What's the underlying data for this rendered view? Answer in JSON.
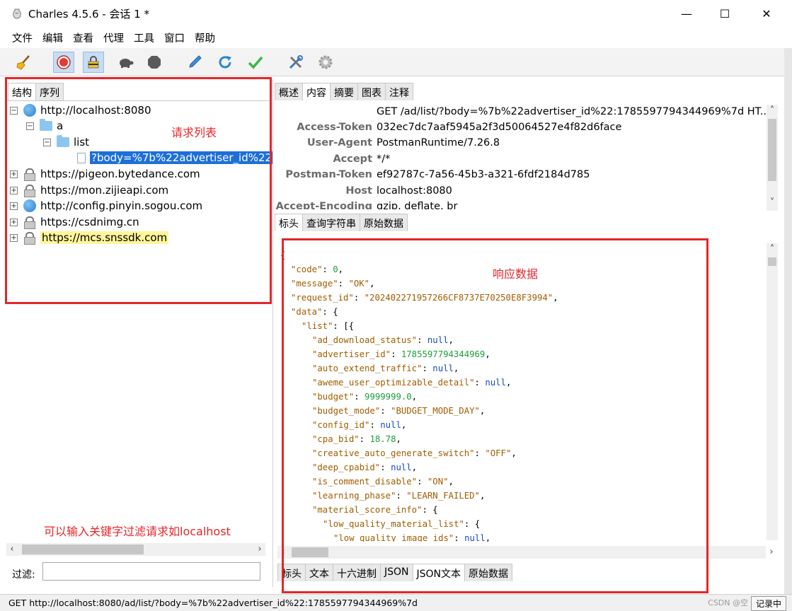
{
  "window": {
    "title": "Charles 4.5.6 - 会话 1 *",
    "minimize": "—",
    "maximize": "☐",
    "close": "✕"
  },
  "menu": [
    "文件",
    "编辑",
    "查看",
    "代理",
    "工具",
    "窗口",
    "帮助"
  ],
  "toolbar": {
    "buttons": [
      "broom-icon",
      "record-icon",
      "ssl-lock-icon",
      "throttle-turtle-icon",
      "breakpoint-hexagon-icon",
      "compose-pen-icon",
      "repeat-icon",
      "validate-check-icon",
      "tools-icon",
      "settings-gear-icon"
    ]
  },
  "left": {
    "tabs": [
      "结构",
      "序列"
    ],
    "tree": [
      {
        "label": "http://localhost:8080",
        "kind": "http",
        "expanded": true
      },
      {
        "label": "a",
        "kind": "folder"
      },
      {
        "label": "list",
        "kind": "folder"
      },
      {
        "label": "?body=%7b%22advertiser_id%22",
        "kind": "request",
        "selected": true
      },
      {
        "label": "https://pigeon.bytedance.com",
        "kind": "https"
      },
      {
        "label": "https://mon.zijieapi.com",
        "kind": "https"
      },
      {
        "label": "http://config.pinyin.sogou.com",
        "kind": "http"
      },
      {
        "label": "https://csdnimg.cn",
        "kind": "https"
      },
      {
        "label": "https://mcs.snssdk.com",
        "kind": "https",
        "highlighted": true
      }
    ],
    "filter_label": "过滤:",
    "filter_value": "",
    "annotation_list": "请求列表",
    "annotation_filter": "可以输入关键字过滤请求如localhost"
  },
  "right": {
    "tabs": [
      "概述",
      "内容",
      "摘要",
      "图表",
      "注释"
    ],
    "request_headers": [
      {
        "key": "",
        "value": "GET /ad/list/?body=%7b%22advertiser_id%22:1785597794344969%7d HT..."
      },
      {
        "key": "Access-Token",
        "value": "032ec7dc7aaf5945a2f3d50064527e4f82d6face"
      },
      {
        "key": "User-Agent",
        "value": "PostmanRuntime/7.26.8"
      },
      {
        "key": "Accept",
        "value": "*/*"
      },
      {
        "key": "Postman-Token",
        "value": "ef92787c-7a56-45b3-a321-6fdf2184d785"
      },
      {
        "key": "Host",
        "value": "localhost:8080"
      },
      {
        "key": "Accept-Encoding",
        "value": "gzip, deflate, br"
      }
    ],
    "request_tabs": [
      "标头",
      "查询字符串",
      "原始数据"
    ],
    "response_tabs": [
      "标头",
      "文本",
      "十六进制",
      "JSON",
      "JSON文本",
      "原始数据"
    ],
    "annotation_response": "响应数据",
    "json_lines": [
      {
        "indent": 0,
        "text": "{",
        "kind": "brace"
      },
      {
        "indent": 1,
        "key": "code",
        "value": "0",
        "type": "number",
        "comma": true
      },
      {
        "indent": 1,
        "key": "message",
        "value": "\"OK\"",
        "type": "string",
        "comma": true
      },
      {
        "indent": 1,
        "key": "request_id",
        "value": "\"202402271957266CF8737E70250E8F3994\"",
        "type": "string",
        "comma": true
      },
      {
        "indent": 1,
        "key": "data",
        "value": "{",
        "type": "punct",
        "comma": false
      },
      {
        "indent": 2,
        "key": "list",
        "value": "[{",
        "type": "punct",
        "comma": false
      },
      {
        "indent": 3,
        "key": "ad_download_status",
        "value": "null",
        "type": "null",
        "comma": true
      },
      {
        "indent": 3,
        "key": "advertiser_id",
        "value": "1785597794344969",
        "type": "number",
        "comma": true
      },
      {
        "indent": 3,
        "key": "auto_extend_traffic",
        "value": "null",
        "type": "null",
        "comma": true
      },
      {
        "indent": 3,
        "key": "aweme_user_optimizable_detail",
        "value": "null",
        "type": "null",
        "comma": true
      },
      {
        "indent": 3,
        "key": "budget",
        "value": "9999999.0",
        "type": "number",
        "comma": true
      },
      {
        "indent": 3,
        "key": "budget_mode",
        "value": "\"BUDGET_MODE_DAY\"",
        "type": "string",
        "comma": true
      },
      {
        "indent": 3,
        "key": "config_id",
        "value": "null",
        "type": "null",
        "comma": true
      },
      {
        "indent": 3,
        "key": "cpa_bid",
        "value": "18.78",
        "type": "number",
        "comma": true
      },
      {
        "indent": 3,
        "key": "creative_auto_generate_switch",
        "value": "\"OFF\"",
        "type": "string",
        "comma": true
      },
      {
        "indent": 3,
        "key": "deep_cpabid",
        "value": "null",
        "type": "null",
        "comma": true
      },
      {
        "indent": 3,
        "key": "is_comment_disable",
        "value": "\"ON\"",
        "type": "string",
        "comma": true
      },
      {
        "indent": 3,
        "key": "learning_phase",
        "value": "\"LEARN_FAILED\"",
        "type": "string",
        "comma": true
      },
      {
        "indent": 3,
        "key": "material_score_info",
        "value": "{",
        "type": "punct",
        "comma": false
      },
      {
        "indent": 4,
        "key": "low_quality_material_list",
        "value": "{",
        "type": "punct",
        "comma": false
      },
      {
        "indent": 5,
        "key": "low_quality_image_ids",
        "value": "null",
        "type": "null",
        "comma": true
      }
    ]
  },
  "status": {
    "text": "GET http://localhost:8080/ad/list/?body=%7b%22advertiser_id%22:1785597794344969%7d",
    "recording": "记录中",
    "watermark": "CSDN @空"
  },
  "colors": {
    "annotation_red": "#e4262a",
    "selection_blue": "#1e6fd9",
    "highlight_yellow": "#fff59a"
  }
}
